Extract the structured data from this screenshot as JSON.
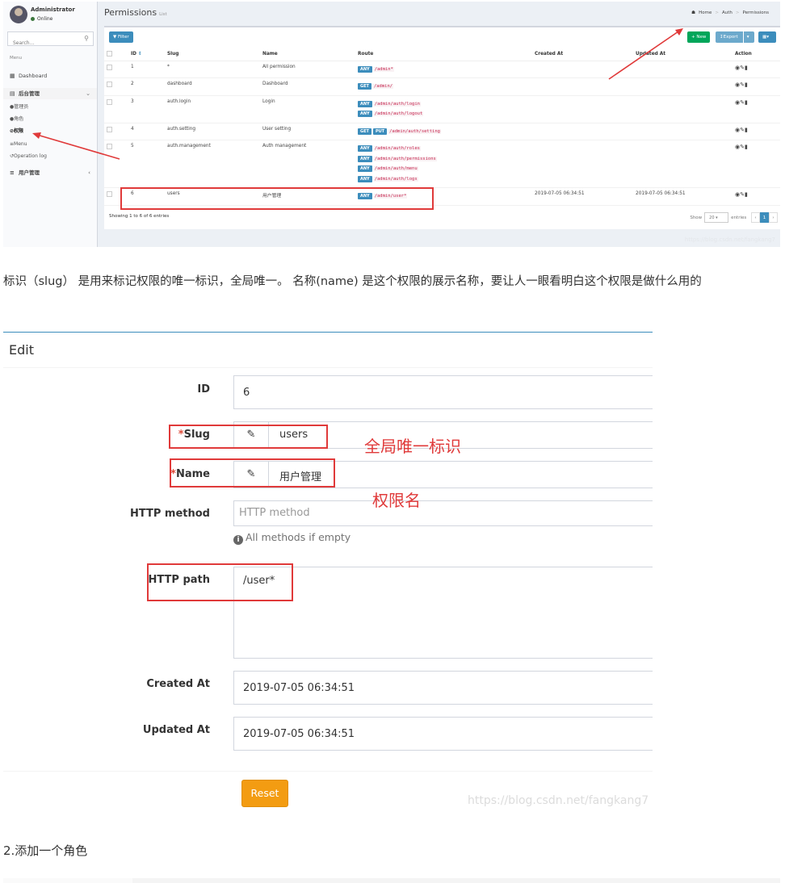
{
  "sidebar": {
    "user_name": "Administrator",
    "status": "Online",
    "search_placeholder": "Search...",
    "menu_header": "Menu",
    "items": [
      {
        "label": "Dashboard",
        "icon": "bar-chart-icon"
      },
      {
        "label": "后台管理",
        "icon": "table-icon"
      },
      {
        "label": "管理员",
        "icon": "users-icon"
      },
      {
        "label": "角色",
        "icon": "user-icon"
      },
      {
        "label": "权限",
        "icon": "ban-icon"
      },
      {
        "label": "Menu",
        "icon": "bars-icon"
      },
      {
        "label": "Operation log",
        "icon": "history-icon"
      },
      {
        "label": "用户管理",
        "icon": "bars-icon"
      }
    ]
  },
  "header": {
    "title": "Permissions",
    "subtitle": "List",
    "breadcrumb": [
      "Home",
      "Auth",
      "Permissions"
    ]
  },
  "toolbar": {
    "filter": "Filter",
    "new": "New",
    "export": "Export"
  },
  "table": {
    "columns": [
      "ID",
      "Slug",
      "Name",
      "Route",
      "Created At",
      "Updated At",
      "Action"
    ],
    "rows": [
      {
        "id": "1",
        "slug": "*",
        "name": "All permission",
        "routes": [
          [
            "ANY",
            "/admin*"
          ]
        ],
        "created": "",
        "updated": ""
      },
      {
        "id": "2",
        "slug": "dashboard",
        "name": "Dashboard",
        "routes": [
          [
            "GET",
            "/admin/"
          ]
        ],
        "created": "",
        "updated": ""
      },
      {
        "id": "3",
        "slug": "auth.login",
        "name": "Login",
        "routes": [
          [
            "ANY",
            "/admin/auth/login"
          ],
          [
            "ANY",
            "/admin/auth/logout"
          ]
        ],
        "created": "",
        "updated": ""
      },
      {
        "id": "4",
        "slug": "auth.setting",
        "name": "User setting",
        "routes": [
          [
            "GET PUT",
            "/admin/auth/setting"
          ]
        ],
        "created": "",
        "updated": ""
      },
      {
        "id": "5",
        "slug": "auth.management",
        "name": "Auth management",
        "routes": [
          [
            "ANY",
            "/admin/auth/roles"
          ],
          [
            "ANY",
            "/admin/auth/permissions"
          ],
          [
            "ANY",
            "/admin/auth/menu"
          ],
          [
            "ANY",
            "/admin/auth/logs"
          ]
        ],
        "created": "",
        "updated": ""
      },
      {
        "id": "6",
        "slug": "users",
        "name": "用户管理",
        "routes": [
          [
            "ANY",
            "/admin/user*"
          ]
        ],
        "created": "2019-07-05 06:34:51",
        "updated": "2019-07-05 06:34:51"
      }
    ],
    "footer": "Showing 1 to 6 of 6 entries",
    "show": "Show",
    "per_page": "20",
    "entries": "entries",
    "page": "1"
  },
  "watermark_top": "https://blog.csdn.net/fangkang7",
  "paragraph": "标识（slug） 是用来标记权限的唯一标识，全局唯一。 名称(name) 是这个权限的展示名称，要让人一眼看明白这个权限是做什么用的",
  "edit": {
    "title": "Edit",
    "id_label": "ID",
    "id_value": "6",
    "slug_label": "Slug",
    "slug_value": "users",
    "name_label": "Name",
    "name_value": "用户管理",
    "method_label": "HTTP method",
    "method_placeholder": "HTTP method",
    "method_help": "All methods if empty",
    "path_label": "HTTP path",
    "path_value": "/user*",
    "created_label": "Created At",
    "created_value": "2019-07-05 06:34:51",
    "updated_label": "Updated At",
    "updated_value": "2019-07-05 06:34:51",
    "reset": "Reset",
    "watermark": "https://blog.csdn.net/fangkang7"
  },
  "annotations": {
    "slug_note": "全局唯一标识",
    "name_note": "权限名"
  },
  "section_heading": "2.添加一个角色",
  "colors": {
    "primary": "#3c8dbc",
    "success": "#00a65a",
    "warning": "#f39c12",
    "annotation_red": "#e03a3a"
  }
}
